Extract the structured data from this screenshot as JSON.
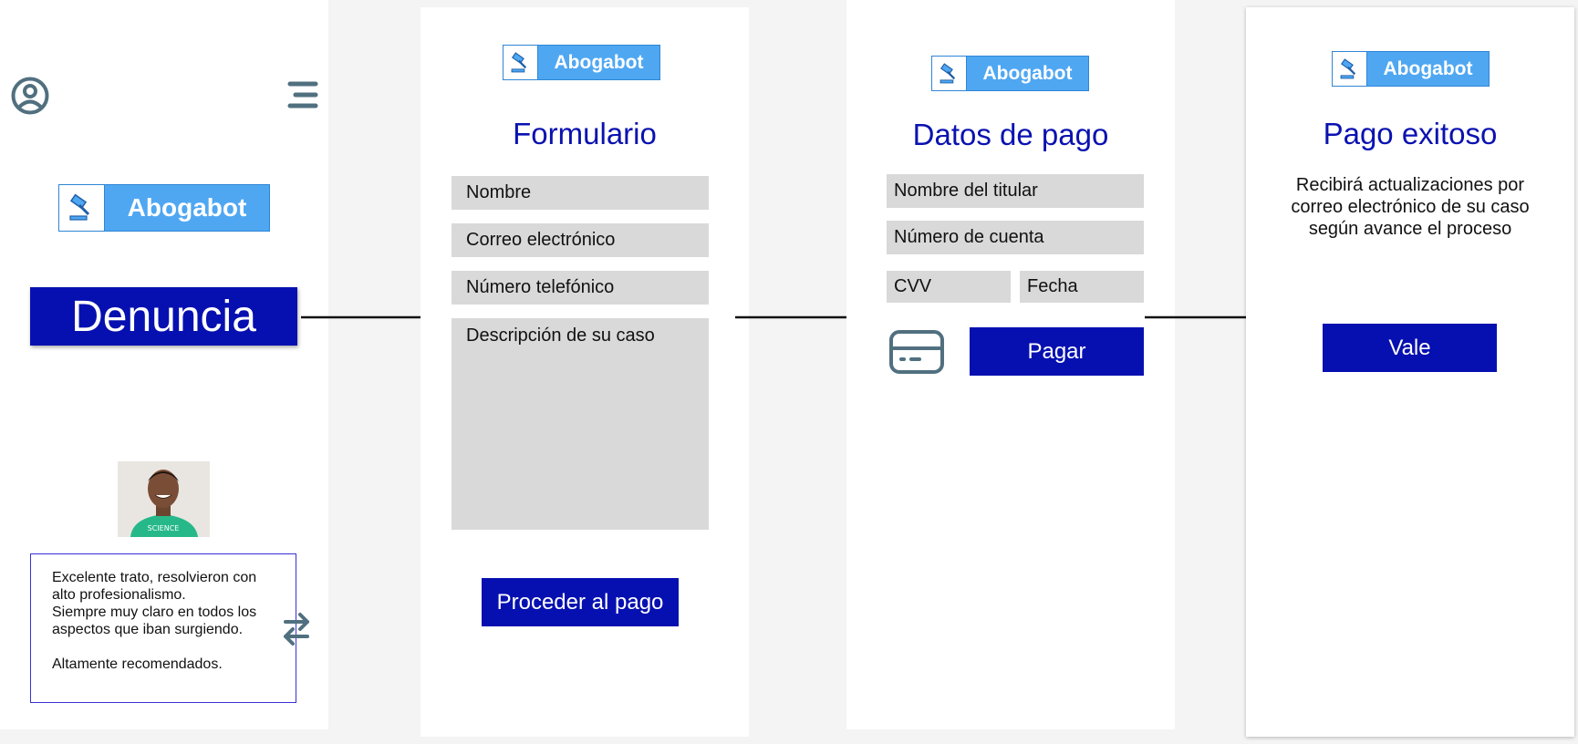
{
  "brand": {
    "logo_text": "Abogabot",
    "primary_color": "#0610b0",
    "logo_color": "#4fa7f2"
  },
  "screen_home": {
    "user_icon": "user-circle-icon",
    "menu_icon": "hamburger-menu-icon",
    "denuncia_label": "Denuncia",
    "review": {
      "lines": [
        "Excelente trato, resolvieron con",
        "alto profesionalismo.",
        "Siempre muy claro en todos los",
        "aspectos que iban surgiendo.",
        "",
        "Altamente recomendados."
      ],
      "swap_icon": "swap-arrows-icon"
    }
  },
  "screen_form": {
    "title": "Formulario",
    "fields": {
      "name": "Nombre",
      "email": "Correo electrónico",
      "phone": "Número telefónico",
      "description": "Descripción de su caso"
    },
    "submit_label": "Proceder al pago"
  },
  "screen_payment": {
    "title": "Datos de pago",
    "fields": {
      "holder": "Nombre del titular",
      "account": "Número de cuenta",
      "cvv": "CVV",
      "date": "Fecha"
    },
    "card_icon": "credit-card-icon",
    "pay_label": "Pagar"
  },
  "screen_success": {
    "title": "Pago exitoso",
    "message_lines": [
      "Recibirá actualizaciones por",
      "correo electrónico de su caso",
      "según avance el proceso"
    ],
    "ok_label": "Vale"
  }
}
